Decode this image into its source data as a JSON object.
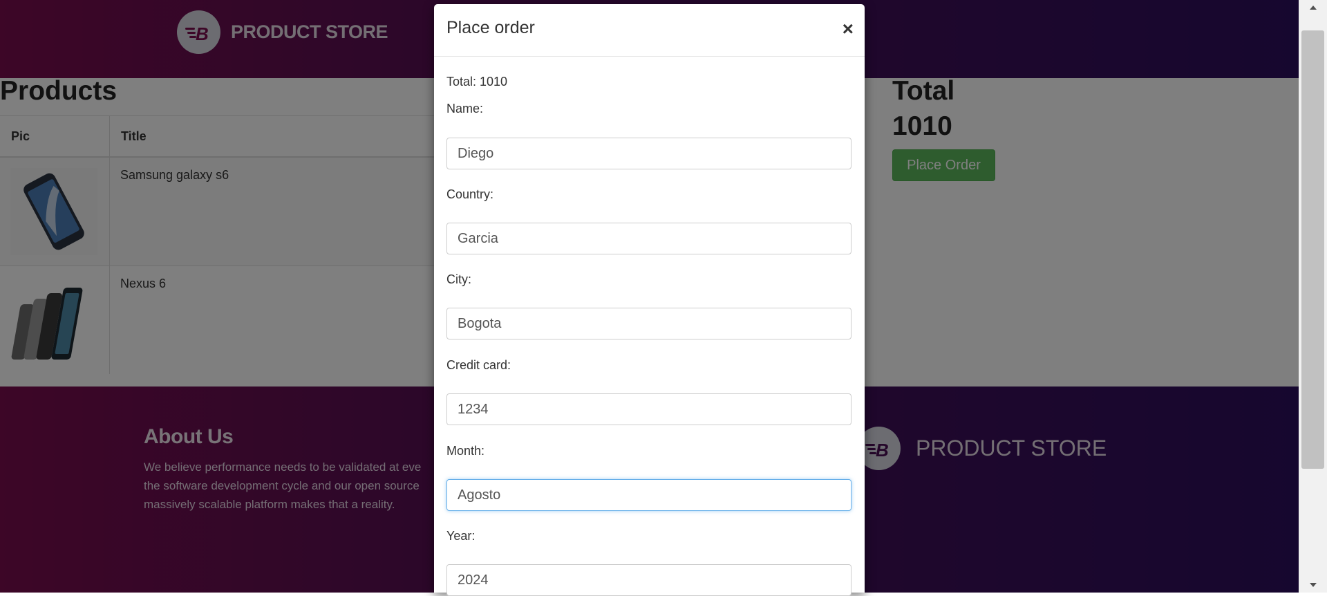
{
  "header": {
    "brand": "PRODUCT STORE"
  },
  "cart": {
    "title": "Products",
    "columns": [
      "Pic",
      "Title"
    ],
    "rows": [
      {
        "title": "Samsung galaxy s6",
        "image": "samsung-galaxy-s6-photo"
      },
      {
        "title": "Nexus 6",
        "image": "nexus-6-photo"
      }
    ],
    "total_label": "Total",
    "total_value": "1010",
    "place_order": "Place Order"
  },
  "footer": {
    "about_title": "About Us",
    "about_lines": [
      "We believe performance needs to be validated at eve",
      "the software development cycle and our open source",
      "massively scalable platform makes that a reality."
    ],
    "brand": "PRODUCT STORE"
  },
  "modal": {
    "title": "Place order",
    "close": "×",
    "total": "Total: 1010",
    "fields": [
      {
        "label": "Name:",
        "value": "Diego"
      },
      {
        "label": "Country:",
        "value": "Garcia"
      },
      {
        "label": "City:",
        "value": "Bogota"
      },
      {
        "label": "Credit card:",
        "value": "1234"
      },
      {
        "label": "Month:",
        "value": "Agosto"
      },
      {
        "label": "Year:",
        "value": "2024"
      }
    ]
  },
  "colors": {
    "header_gradient": [
      "#7a0d4e",
      "#2d0e5e"
    ],
    "primary_button": "#5cb85c",
    "focus_border": "#66afe9"
  },
  "icons": [
    "logo-icon",
    "close-icon",
    "scroll-up-icon",
    "scroll-down-icon"
  ]
}
